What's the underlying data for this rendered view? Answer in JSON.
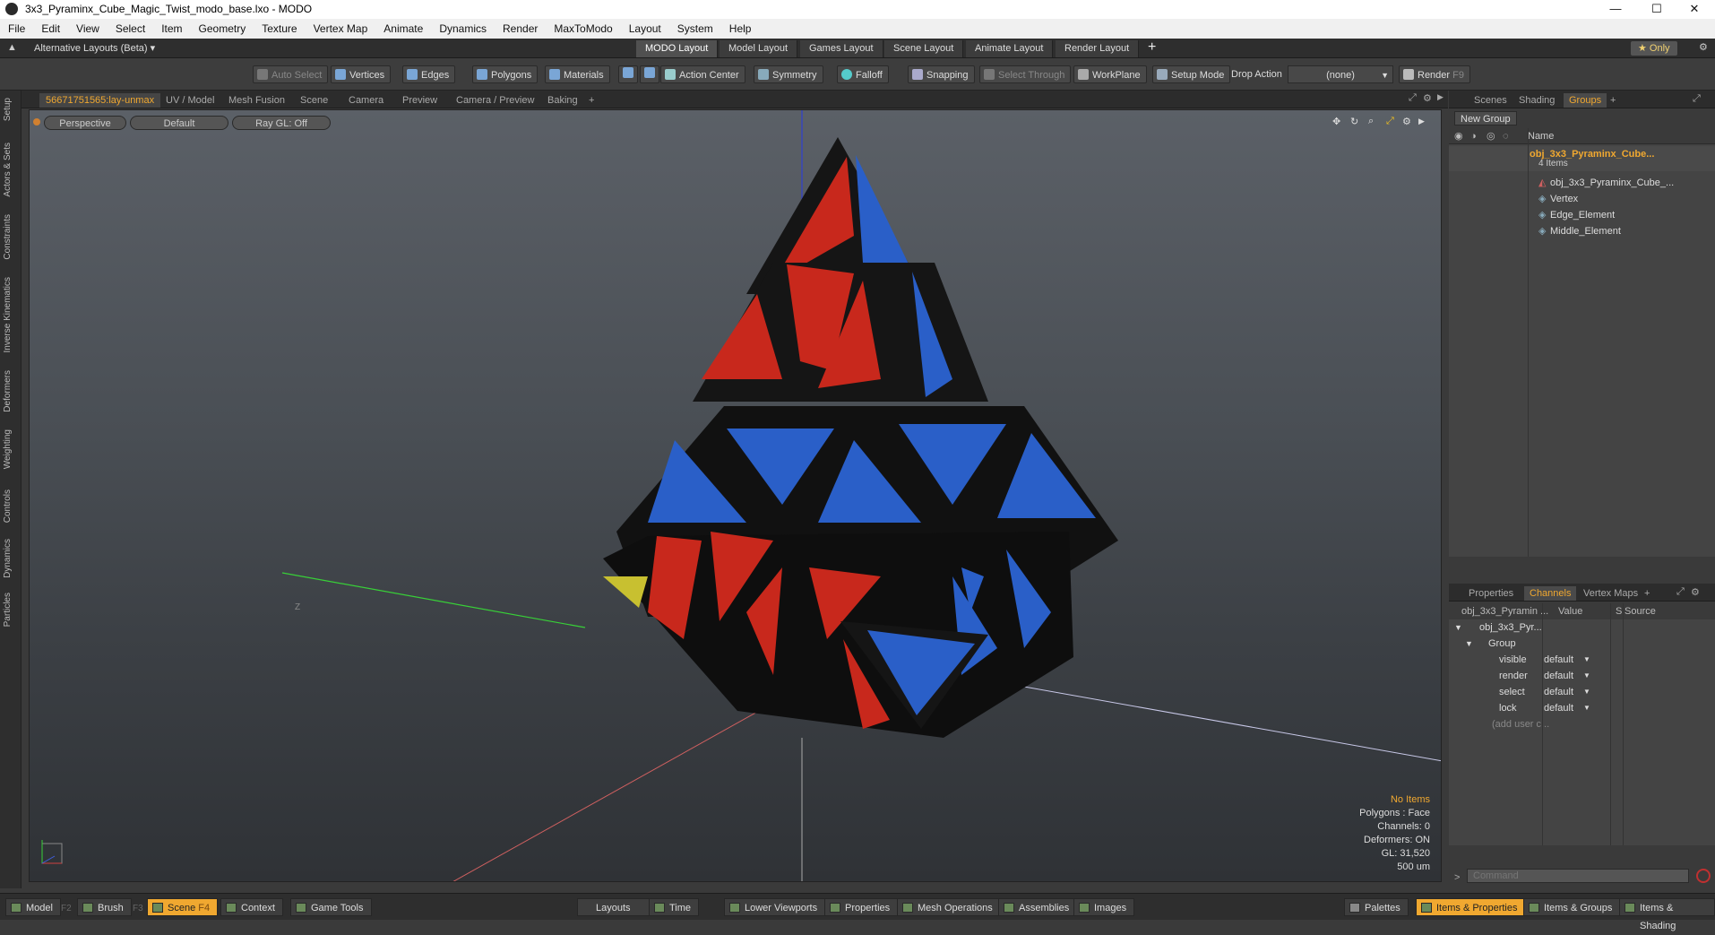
{
  "window": {
    "title": "3x3_Pyraminx_Cube_Magic_Twist_modo_base.lxo - MODO",
    "minimize": "—",
    "maximize": "☐",
    "close": "✕"
  },
  "menu": [
    "File",
    "Edit",
    "View",
    "Select",
    "Item",
    "Geometry",
    "Texture",
    "Vertex Map",
    "Animate",
    "Dynamics",
    "Render",
    "MaxToModo",
    "Layout",
    "System",
    "Help"
  ],
  "layout_bar": {
    "alt_layouts": "Alternative Layouts (Beta) ▾",
    "tabs": [
      "MODO Layout",
      "Model Layout",
      "Games Layout",
      "Scene Layout",
      "Animate Layout",
      "Render Layout"
    ],
    "active_tab": "MODO Layout",
    "add": "+",
    "only": "★  Only"
  },
  "toolbar": {
    "auto_select": "Auto Select",
    "vertices": "Vertices",
    "edges": "Edges",
    "polygons": "Polygons",
    "materials": "Materials",
    "action_center": "Action Center",
    "symmetry": "Symmetry",
    "falloff": "Falloff",
    "snapping": "Snapping",
    "select_through": "Select Through",
    "workplane": "WorkPlane",
    "setup_mode": "Setup Mode",
    "drop_action": "Drop Action",
    "drop_value": "(none)",
    "render": "Render",
    "render_key": "F9"
  },
  "left_tabs": [
    "Setup",
    "Actors & Sets",
    "Constraints",
    "Inverse Kinematics",
    "Deformers",
    "Weighting",
    "Controls",
    "Dynamics",
    "Particles"
  ],
  "viewport_tabs": [
    "56671751565:lay-unmax",
    "UV / Model",
    "Mesh Fusion",
    "Scene",
    "Camera",
    "Preview",
    "Camera / Preview",
    "Baking",
    "+"
  ],
  "viewport": {
    "view": "Perspective",
    "shading": "Default",
    "raygl": "Ray GL: Off",
    "axis_label": "Z",
    "info": {
      "no_items": "No Items",
      "polygons": "Polygons : Face",
      "channels": "Channels: 0",
      "deformers": "Deformers: ON",
      "gl": "GL: 31,520",
      "scale": "500 um"
    }
  },
  "colors": {
    "accent": "#f0a830",
    "red": "#c8281c",
    "blue": "#2a5fc8",
    "yellow": "#c8c030"
  },
  "right_panel": {
    "top_tabs": [
      "Scenes",
      "Shading",
      "Groups",
      "+"
    ],
    "active_top": "Groups",
    "new_group": "New Group",
    "name_header": "Name",
    "group_name": "obj_3x3_Pyraminx_Cube...",
    "group_count": "4 Items",
    "items": [
      "obj_3x3_Pyraminx_Cube_...",
      "Vertex",
      "Edge_Element",
      "Middle_Element"
    ],
    "bottom_tabs": [
      "Properties",
      "Channels",
      "Vertex Maps",
      "+"
    ],
    "active_bottom": "Channels",
    "ch_headers": {
      "name": "obj_3x3_Pyramin ...",
      "value": "Value",
      "s": "S",
      "source": "Source"
    },
    "ch_obj": "obj_3x3_Pyr...",
    "ch_group": "Group",
    "channels": [
      {
        "name": "visible",
        "value": "default"
      },
      {
        "name": "render",
        "value": "default"
      },
      {
        "name": "select",
        "value": "default"
      },
      {
        "name": "lock",
        "value": "default"
      }
    ],
    "add_user": "(add user c...",
    "command_placeholder": "Command"
  },
  "bottom_bar": {
    "model": "Model",
    "model_key": "F2",
    "brush": "Brush",
    "brush_key": "F3",
    "scene": "Scene",
    "scene_key": "F4",
    "context": "Context",
    "game_tools": "Game Tools",
    "layouts": "Layouts",
    "time": "Time",
    "lower_viewports": "Lower Viewports",
    "properties": "Properties",
    "mesh_operations": "Mesh Operations",
    "assemblies": "Assemblies",
    "images": "Images",
    "palettes": "Palettes",
    "items_properties": "Items & Properties",
    "items_groups": "Items & Groups",
    "items_shading": "Items & Shading"
  }
}
